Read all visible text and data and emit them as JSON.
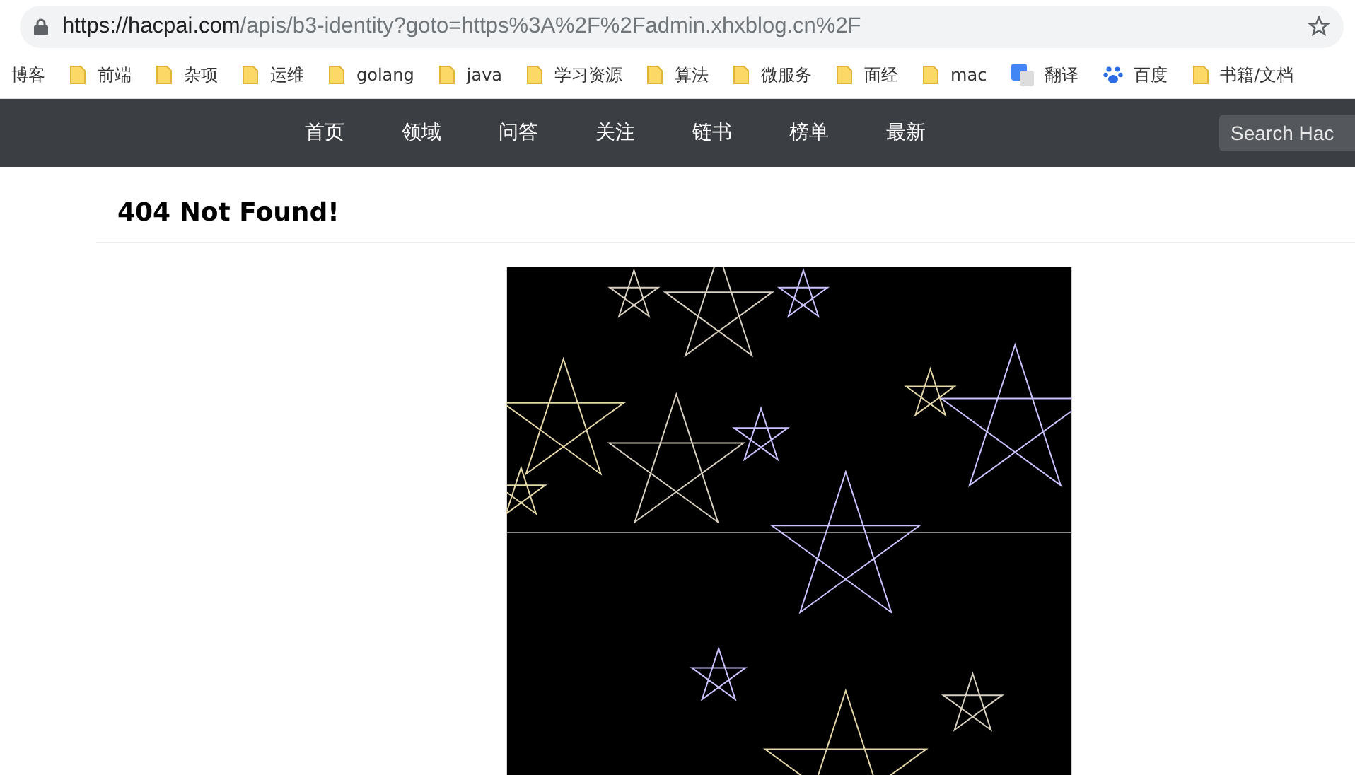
{
  "address_bar": {
    "host": "https://hacpai.com",
    "path": "/apis/b3-identity?goto=https%3A%2F%2Fadmin.xhxblog.cn%2F"
  },
  "bookmarks": [
    {
      "label": "博客",
      "kind": "plain"
    },
    {
      "label": "前端",
      "kind": "folder"
    },
    {
      "label": "杂项",
      "kind": "folder"
    },
    {
      "label": "运维",
      "kind": "folder"
    },
    {
      "label": "golang",
      "kind": "folder"
    },
    {
      "label": "java",
      "kind": "folder"
    },
    {
      "label": "学习资源",
      "kind": "folder"
    },
    {
      "label": "算法",
      "kind": "folder"
    },
    {
      "label": "微服务",
      "kind": "folder"
    },
    {
      "label": "面经",
      "kind": "folder"
    },
    {
      "label": "mac",
      "kind": "folder"
    },
    {
      "label": "翻译",
      "kind": "translate"
    },
    {
      "label": "百度",
      "kind": "paw"
    },
    {
      "label": "书籍/文档",
      "kind": "folder"
    }
  ],
  "nav": {
    "items": [
      "首页",
      "领域",
      "问答",
      "关注",
      "链书",
      "榜单",
      "最新"
    ],
    "search": {
      "placeholder": "Search Hac"
    }
  },
  "page": {
    "heading": "404 Not Found!"
  }
}
